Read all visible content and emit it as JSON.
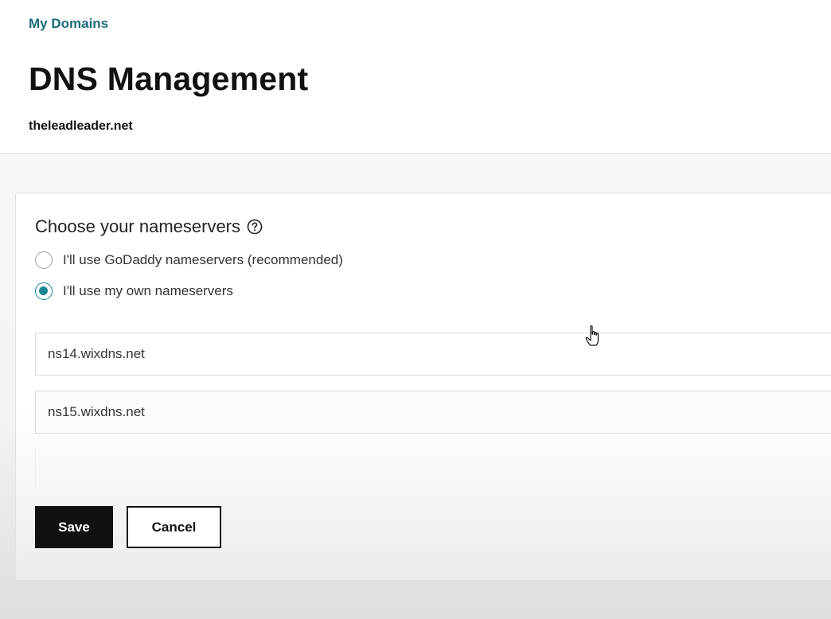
{
  "header": {
    "breadcrumb": "My Domains",
    "title": "DNS Management",
    "domain": "theleadleader.net"
  },
  "nameservers": {
    "section_title": "Choose your nameservers",
    "help_icon": "question-circle-icon",
    "options": [
      {
        "label": "I'll use GoDaddy nameservers (recommended)",
        "selected": false
      },
      {
        "label": "I'll use my own nameservers",
        "selected": true
      }
    ],
    "fields": [
      {
        "value": "ns14.wixdns.net"
      },
      {
        "value": "ns15.wixdns.net"
      }
    ]
  },
  "actions": {
    "save_label": "Save",
    "cancel_label": "Cancel"
  },
  "colors": {
    "accent": "#1b8795",
    "breadcrumb": "#1b6b78",
    "primary_button": "#111111"
  },
  "cursor": "hand-pointer-icon"
}
